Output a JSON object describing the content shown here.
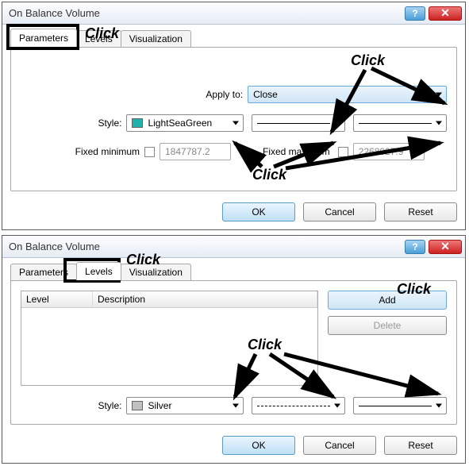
{
  "dialog1": {
    "title": "On Balance Volume",
    "tabs": {
      "parameters": "Parameters",
      "levels": "Levels",
      "visualization": "Visualization"
    },
    "apply_to_label": "Apply to:",
    "apply_to_value": "Close",
    "style_label": "Style:",
    "style_color_name": "LightSeaGreen",
    "style_color_hex": "#20B2AA",
    "fixed_min_label": "Fixed minimum",
    "fixed_min_value": "1847787.2",
    "fixed_max_label": "Fixed maximum",
    "fixed_max_value": "2268027.9",
    "buttons": {
      "ok": "OK",
      "cancel": "Cancel",
      "reset": "Reset"
    }
  },
  "dialog2": {
    "title": "On Balance Volume",
    "tabs": {
      "parameters": "Parameters",
      "levels": "Levels",
      "visualization": "Visualization"
    },
    "columns": {
      "level": "Level",
      "description": "Description"
    },
    "side": {
      "add": "Add",
      "delete": "Delete"
    },
    "style_label": "Style:",
    "style_color_name": "Silver",
    "style_color_hex": "#C0C0C0",
    "buttons": {
      "ok": "OK",
      "cancel": "Cancel",
      "reset": "Reset"
    }
  },
  "annotations": {
    "click": "Click"
  }
}
